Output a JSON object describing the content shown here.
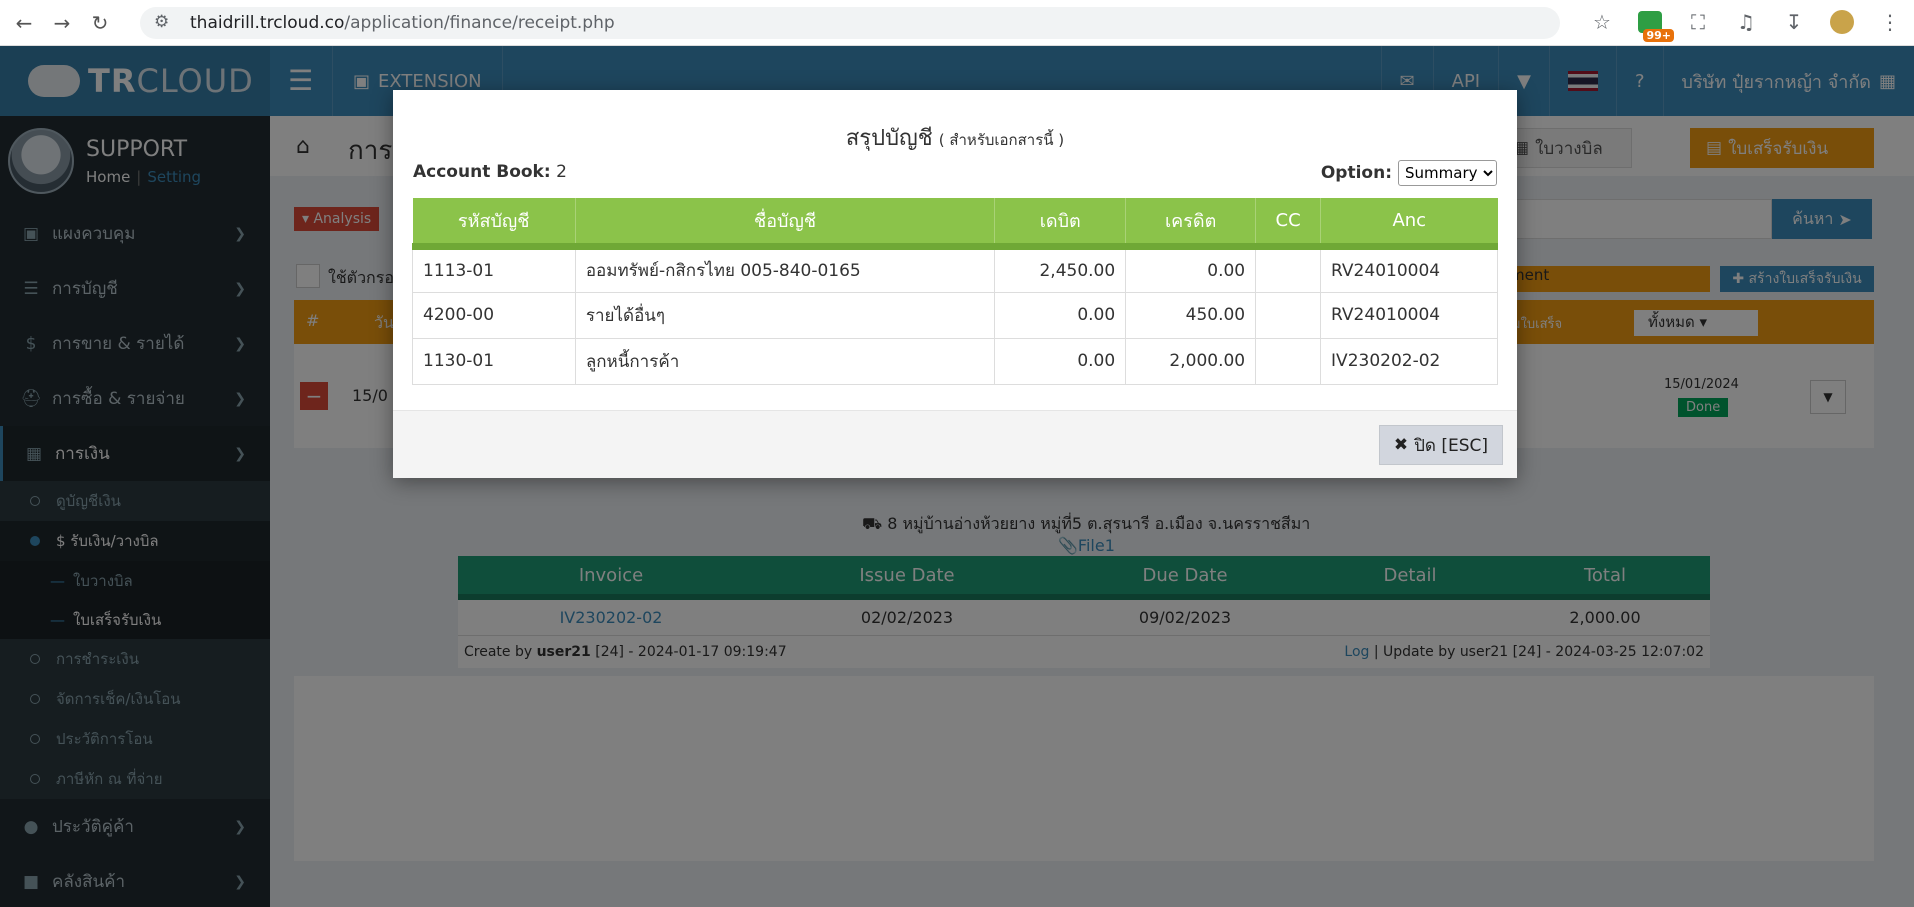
{
  "browser": {
    "url_host": "thaidrill.trcloud.co",
    "url_path": "/application/finance/receipt.php",
    "badge": "99+"
  },
  "app": {
    "logo_tr": "TR",
    "logo_cloud": "CLOUD",
    "user_name": "SUPPORT",
    "link_home": "Home",
    "link_sep": "|",
    "link_setting": "Setting",
    "extension": "EXTENSION",
    "api": "API",
    "company": "บริษัท ปุ๋ยรากหญ้า จำกัด",
    "page_title": "การ",
    "btn_billing": "ใบวางบิล",
    "btn_receipt": "ใบเสร็จรับเงิน",
    "analysis": "Analysis",
    "search": "ค้นหา",
    "checkbox_label": "ใช้ตัวกรอ",
    "select_value": "ment",
    "create_receipt": "สร้างใบเสร็จรับเงิน",
    "hash": "#",
    "col_partial": "วัน",
    "col_receipt_partial": "มใบเสร็จ",
    "select_all": "ทั้งหมด",
    "row_date": "15/0",
    "row_right_date": "15/01/2024",
    "done": "Done",
    "address": "8 หมู่บ้านอ่างห้วยยาง หมู่ที่5 ต.สุรนารี อ.เมือง จ.นครราชสีมา",
    "file": "File1"
  },
  "sidebar": {
    "items": [
      {
        "label": "แผงควบคุม",
        "icon": "monitor-icon"
      },
      {
        "label": "การบัญชี",
        "icon": "book-icon"
      },
      {
        "label": "การขาย & รายได้",
        "icon": "dollar-icon"
      },
      {
        "label": "การซื้อ & รายจ่าย",
        "icon": "cart-icon"
      },
      {
        "label": "การเงิน",
        "icon": "calendar-icon"
      }
    ],
    "sub": [
      {
        "label": "ดูบัญชีเงิน"
      },
      {
        "label": "$ รับเงิน/วางบิล"
      }
    ],
    "sub2": [
      {
        "label": "ใบวางบิล"
      },
      {
        "label": "ใบเสร็จรับเงิน"
      }
    ],
    "sub3": [
      {
        "label": "การชำระเงิน"
      },
      {
        "label": "จัดการเช็ค/เงินโอน"
      },
      {
        "label": "ประวัติการโอน"
      },
      {
        "label": "ภาษีหัก ณ ที่จ่าย"
      }
    ],
    "items2": [
      {
        "label": "ประวัติคู่ค้า"
      },
      {
        "label": "คลังสินค้า"
      }
    ]
  },
  "invoice_table": {
    "headers": [
      "Invoice",
      "Issue Date",
      "Due Date",
      "Detail",
      "Total"
    ],
    "row": [
      "IV230202-02",
      "02/02/2023",
      "09/02/2023",
      "",
      "2,000.00"
    ],
    "footer_left_pre": "Create by ",
    "footer_left_user": "user21",
    "footer_left_post": " [24] - 2024-01-17 09:19:47",
    "footer_log": "Log",
    "footer_right": " | Update by user21 [24] - 2024-03-25 12:07:02"
  },
  "modal": {
    "title": "สรุปบัญชี",
    "subtitle": "( สำหรับเอกสารนี้ )",
    "account_book_label": "Account Book:",
    "account_book_value": "2",
    "option_label": "Option:",
    "option_value": "Summary",
    "headers": [
      "รหัสบัญชี",
      "ชื่อบัญชี",
      "เดบิต",
      "เครดิต",
      "CC",
      "Anc"
    ],
    "rows": [
      [
        "1113-01",
        "ออมทรัพย์-กสิกรไทย 005-840-0165",
        "2,450.00",
        "0.00",
        "",
        "RV24010004"
      ],
      [
        "4200-00",
        "รายได้อื่นๆ",
        "0.00",
        "450.00",
        "",
        "RV24010004"
      ],
      [
        "1130-01",
        "ลูกหนี้การค้า",
        "0.00",
        "2,000.00",
        "",
        "IV230202-02"
      ]
    ],
    "close_label": "ปิด [ESC]"
  }
}
